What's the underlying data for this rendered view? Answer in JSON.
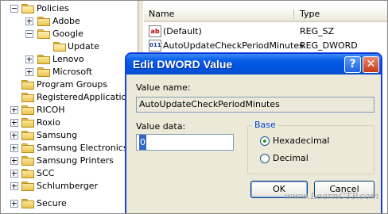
{
  "tree": {
    "items": [
      {
        "label": "Policies",
        "expanded": true,
        "expander": "minus"
      },
      {
        "label": "Adobe",
        "expander": "plus"
      },
      {
        "label": "Google",
        "expander": "minus"
      },
      {
        "label": "Update",
        "open": true,
        "expander": "none"
      },
      {
        "label": "Lenovo",
        "expander": "plus"
      },
      {
        "label": "Microsoft",
        "expander": "plus"
      },
      {
        "label": "Program Groups",
        "expander": "none"
      },
      {
        "label": "RegisteredApplications",
        "expander": "none"
      },
      {
        "label": "RICOH",
        "expander": "plus"
      },
      {
        "label": "Roxio",
        "expander": "plus"
      },
      {
        "label": "Samsung",
        "expander": "plus"
      },
      {
        "label": "Samsung Electronics Co",
        "expander": "plus"
      },
      {
        "label": "Samsung Printers",
        "expander": "plus"
      },
      {
        "label": "SCC",
        "expander": "plus"
      },
      {
        "label": "Schlumberger",
        "expander": "plus"
      },
      {
        "label": "Secure",
        "expander": "plus"
      }
    ]
  },
  "list": {
    "columns": {
      "name": "Name",
      "type": "Type"
    },
    "rows": [
      {
        "icon": "string-value-icon",
        "icon_text": "ab",
        "name": "(Default)",
        "type": "REG_SZ"
      },
      {
        "icon": "dword-value-icon",
        "icon_text": "011",
        "name": "AutoUpdateCheckPeriodMinutes",
        "type": "REG_DWORD"
      }
    ]
  },
  "dialog": {
    "title": "Edit DWORD Value",
    "help_button": "?",
    "close_button": "✕",
    "value_name_label": "Value name:",
    "value_name": "AutoUpdateCheckPeriodMinutes",
    "value_data_label": "Value data:",
    "value_data": "0",
    "base_label": "Base",
    "base_options": [
      {
        "label": "Hexadecimal",
        "selected": true
      },
      {
        "label": "Decimal",
        "selected": false
      }
    ],
    "ok_label": "OK",
    "cancel_label": "Cancel"
  },
  "watermark": "www.LearnCTP.com",
  "colors": {
    "title_bar": "#0054e3",
    "dialog_face": "#ece9d8",
    "group_label": "#0046d5",
    "folder": "#e9c453"
  }
}
